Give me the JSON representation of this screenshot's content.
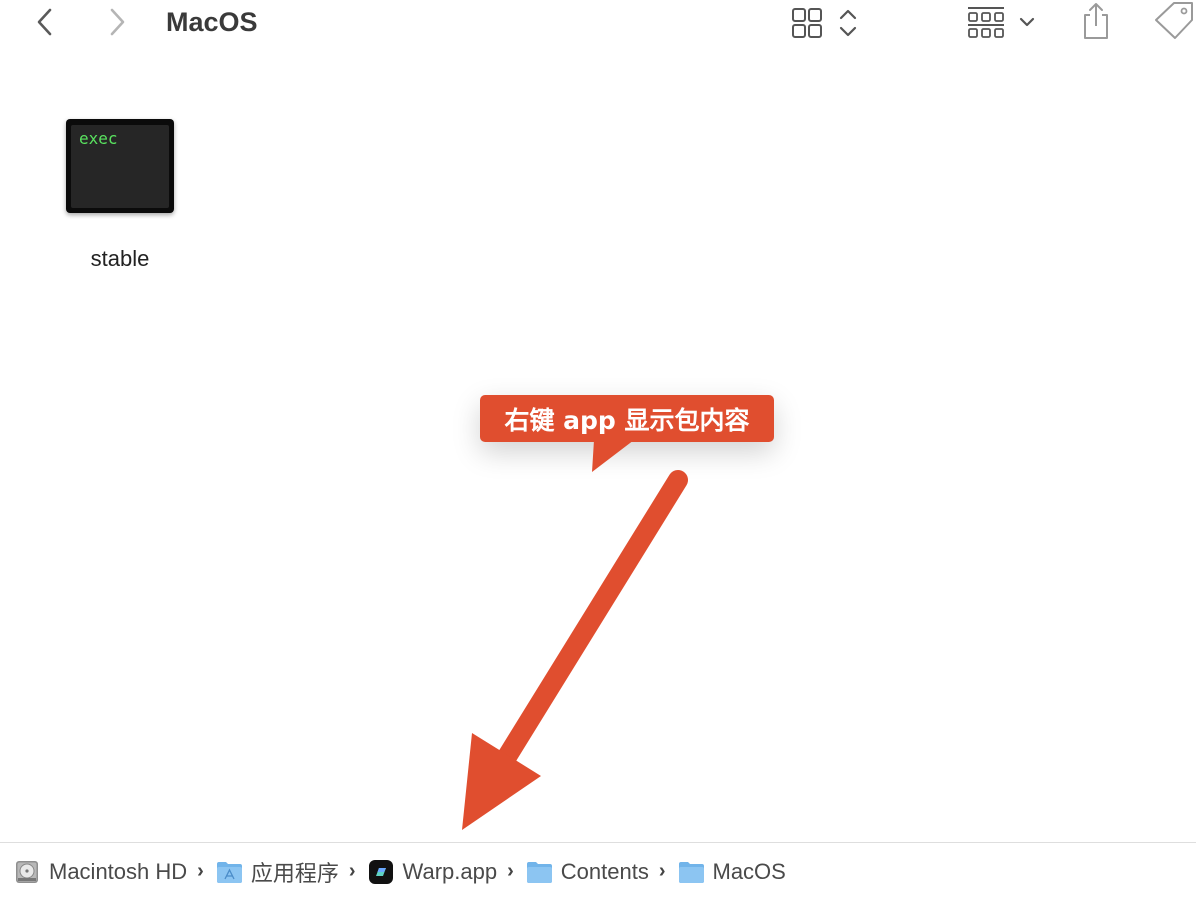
{
  "window": {
    "title": "MacOS"
  },
  "toolbar": {
    "back_icon": "chevron-left-icon",
    "forward_icon": "chevron-right-icon",
    "view_icon": "icon-grid-view-icon",
    "group_icon": "group-by-icon",
    "share_icon": "share-icon",
    "tag_icon": "tag-icon"
  },
  "files": [
    {
      "name": "stable",
      "icon_text": "exec",
      "icon": "unix-executable-icon"
    }
  ],
  "annotation": {
    "text": "右键 app 显示包内容",
    "color": "#e04e2f"
  },
  "pathbar": {
    "items": [
      {
        "label": "Macintosh HD",
        "icon": "hard-drive-icon"
      },
      {
        "label": "应用程序",
        "icon": "applications-folder-icon"
      },
      {
        "label": "Warp.app",
        "icon": "warp-app-icon"
      },
      {
        "label": "Contents",
        "icon": "folder-icon"
      },
      {
        "label": "MacOS",
        "icon": "folder-icon"
      }
    ]
  }
}
